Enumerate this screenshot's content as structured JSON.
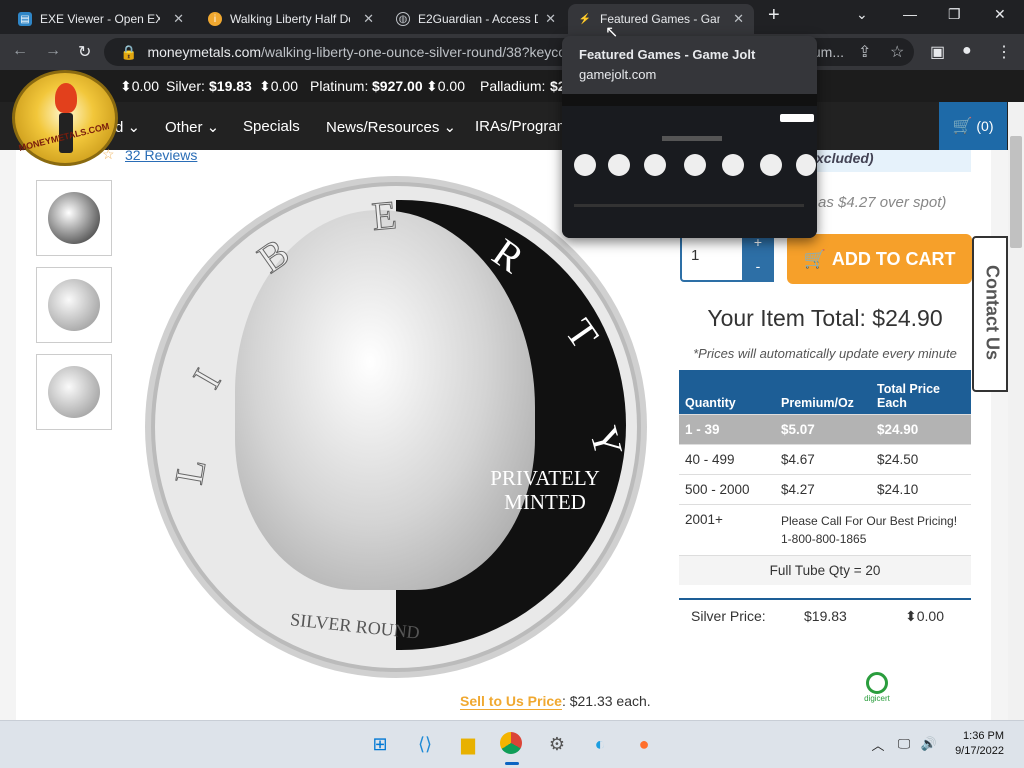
{
  "tabs": [
    {
      "title": "EXE Viewer - Open EXE",
      "icon": "exe-viewer-icon"
    },
    {
      "title": "Walking Liberty Half Do",
      "icon": "info-icon"
    },
    {
      "title": "E2Guardian - Access De",
      "icon": "globe-icon"
    },
    {
      "title": "Featured Games - Gam",
      "icon": "gamejolt-icon",
      "active": true
    }
  ],
  "hovercard": {
    "title": "Featured Games - Game Jolt",
    "domain": "gamejolt.com"
  },
  "omnibox": {
    "host": "moneymetals.com",
    "path": "/walking-liberty-one-ounce-silver-round/38?keyco",
    "tail": "um..."
  },
  "metals": {
    "gold_change": "0.00",
    "silver_label": "Silver:",
    "silver_price": "$19.83",
    "silver_change": "0.00",
    "platinum_label": "Platinum:",
    "platinum_price": "$927.00",
    "platinum_change": "0.00",
    "palladium_label": "Palladium:",
    "palladium_price": "$2"
  },
  "logo_text": "MONEYMETALS.COM",
  "nav": {
    "partial": "d",
    "other": "Other",
    "specials": "Specials",
    "news": "News/Resources",
    "iras": "IRAs/Program",
    "cart": "(0)"
  },
  "reviews": "32 Reviews",
  "coin": {
    "minted": "PRIVATELY MINTED",
    "round": "SILVER ROUND",
    "letters": [
      "L",
      "I",
      "B",
      "E",
      "R",
      "T",
      "Y"
    ]
  },
  "excluded": "xcluded)",
  "spot_note": "as $4.27 over spot)",
  "quantity": "1",
  "add_to_cart": "ADD TO CART",
  "contact_us": "Contact Us",
  "item_total": "Your Item Total: $24.90",
  "price_note": "*Prices will automatically update every minute",
  "price_table": {
    "headers": [
      "Quantity",
      "Premium/Oz",
      "Total Price Each"
    ],
    "rows": [
      [
        "1 - 39",
        "$5.07",
        "$24.90"
      ],
      [
        "40 - 499",
        "$4.67",
        "$24.50"
      ],
      [
        "500 - 2000",
        "$4.27",
        "$24.10"
      ],
      [
        "2001+",
        "Please Call For Our Best Pricing! 1-800-800-1865",
        ""
      ]
    ],
    "footer": "Full Tube Qty = 20"
  },
  "silver_row": {
    "label": "Silver Price:",
    "price": "$19.83",
    "change": "0.00"
  },
  "sell": {
    "label": "Sell to Us Price",
    "value": ": $21.33 each."
  },
  "digicert": "digicert",
  "clock": {
    "time": "1:36 PM",
    "date": "9/17/2022"
  }
}
